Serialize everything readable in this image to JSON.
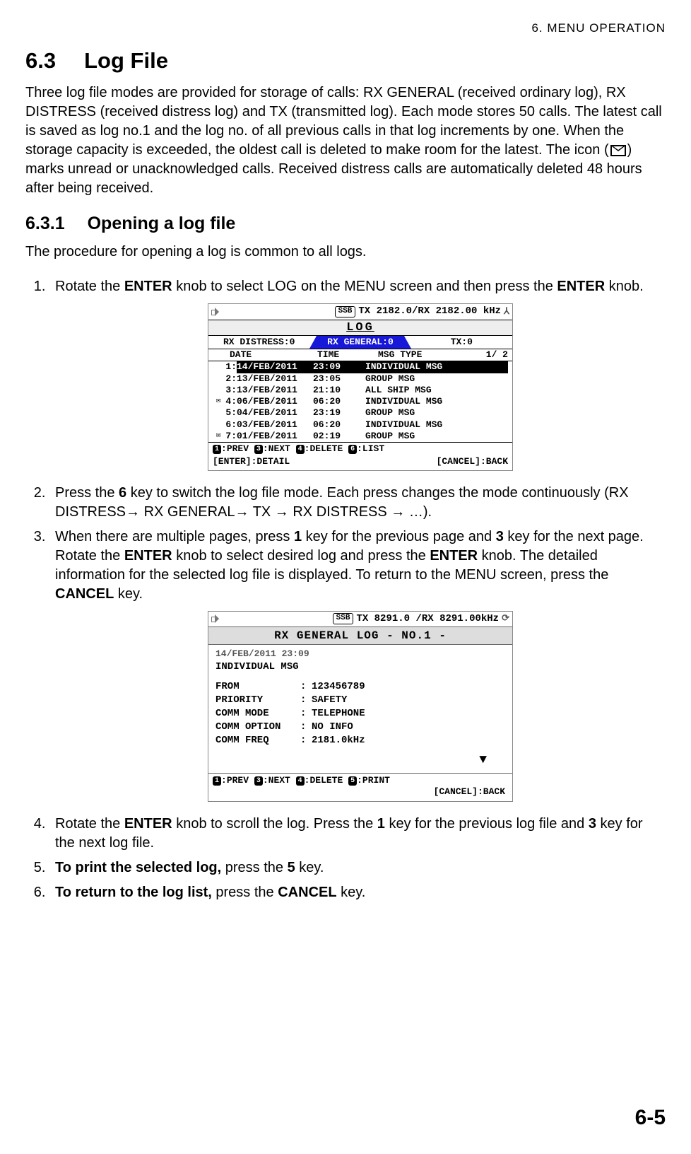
{
  "header": "6.  MENU  OPERATION",
  "section": {
    "num": "6.3",
    "title": "Log File"
  },
  "intro_a": "Three log file modes are provided for storage of calls: RX GENERAL (received ordinary log), RX DISTRESS (received distress log) and TX (transmitted log). Each mode stores 50 calls. The latest call is saved as log no.1 and the log no. of all previous calls in that log increments by one. When the storage capacity is exceeded, the oldest call is deleted to make room for the latest. The icon (",
  "intro_b": ") marks unread or unacknowledged calls. Received distress calls are automatically deleted 48 hours after being received.",
  "subsection": {
    "num": "6.3.1",
    "title": "Opening a log file"
  },
  "sub_intro": "The procedure for opening a log is common to all logs.",
  "step1_a": "Rotate the ",
  "step1_b": " knob to select LOG on the MENU screen and then press the ",
  "step1_c": " knob.",
  "enter": "ENTER",
  "screen1": {
    "ssb": "SSB",
    "freq": "TX 2182.0/RX 2182.00 kHz",
    "title": "LOG",
    "tabs": [
      "RX DISTRESS:0",
      "RX GENERAL:0",
      "TX:0"
    ],
    "hdr": {
      "date": "DATE",
      "time": "TIME",
      "msg": "MSG TYPE",
      "page": "1/ 2"
    },
    "rows": [
      {
        "ico": "",
        "n": "1",
        "date": "14/FEB/2011",
        "time": "23:09",
        "msg": "INDIVIDUAL MSG",
        "sel": true
      },
      {
        "ico": "",
        "n": "2",
        "date": "13/FEB/2011",
        "time": "23:05",
        "msg": "GROUP MSG"
      },
      {
        "ico": "",
        "n": "3",
        "date": "13/FEB/2011",
        "time": "21:10",
        "msg": "ALL SHIP MSG"
      },
      {
        "ico": "✉",
        "n": "4",
        "date": "06/FEB/2011",
        "time": "06:20",
        "msg": "INDIVIDUAL MSG"
      },
      {
        "ico": "",
        "n": "5",
        "date": "04/FEB/2011",
        "time": "23:19",
        "msg": "GROUP MSG"
      },
      {
        "ico": "",
        "n": "6",
        "date": "03/FEB/2011",
        "time": "06:20",
        "msg": "INDIVIDUAL MSG"
      },
      {
        "ico": "✉",
        "n": "7",
        "date": "01/FEB/2011",
        "time": "02:19",
        "msg": "GROUP MSG"
      }
    ],
    "foot_keys": {
      "k1": "1",
      "t1": ":PREV ",
      "k3": "3",
      "t3": ":NEXT ",
      "k4": "4",
      "t4": ":DELETE ",
      "k6": "6",
      "t6": ":LIST"
    },
    "foot2_left": "[ENTER]:DETAIL",
    "foot2_right": "[CANCEL]:BACK"
  },
  "step2_a": "Press the ",
  "step2_b": " key to switch the log file mode. Each press changes the mode continuously (RX DISTRESS→ RX GENERAL→ TX → RX DISTRESS → …).",
  "key6": "6",
  "step3_a": "When there are multiple pages, press ",
  "step3_b": " key for the previous page and ",
  "step3_c": " key for the next page. Rotate the ",
  "step3_d": " knob to select desired log and press the ",
  "step3_e": " knob. The detailed information for the selected log file is displayed. To return to the MENU screen, press the ",
  "step3_f": " key.",
  "key1": "1",
  "key3": "3",
  "cancel": "CANCEL",
  "screen2": {
    "ssb": "SSB",
    "freq": "TX 8291.0 /RX 8291.00kHz",
    "title": "RX GENERAL LOG  - NO.1 -",
    "dt": "14/FEB/2011    23:09",
    "msgtype": "INDIVIDUAL MSG",
    "fields": [
      {
        "lbl": "FROM",
        "val": "123456789"
      },
      {
        "lbl": "PRIORITY",
        "val": "SAFETY"
      },
      {
        "lbl": "COMM MODE",
        "val": "TELEPHONE"
      },
      {
        "lbl": "COMM OPTION",
        "val": "NO INFO"
      },
      {
        "lbl": "COMM FREQ",
        "val": "2181.0kHz"
      }
    ],
    "arrow": "▼",
    "foot_keys": {
      "k1": "1",
      "t1": ":PREV  ",
      "k3": "3",
      "t3": ":NEXT  ",
      "k4": "4",
      "t4": ":DELETE  ",
      "k5": "5",
      "t5": ":PRINT"
    },
    "foot2": "[CANCEL]:BACK"
  },
  "step4_a": "Rotate the ",
  "step4_b": " knob to scroll the log. Press the ",
  "step4_c": " key for the previous log file and ",
  "step4_d": " key for the next log file.",
  "step5_a": "To print the selected log,",
  "step5_b": " press the ",
  "step5_c": " key.",
  "key5": "5",
  "step6_a": "To return to the log list,",
  "step6_b": " press the ",
  "step6_c": " key.",
  "page_num": "6-5"
}
